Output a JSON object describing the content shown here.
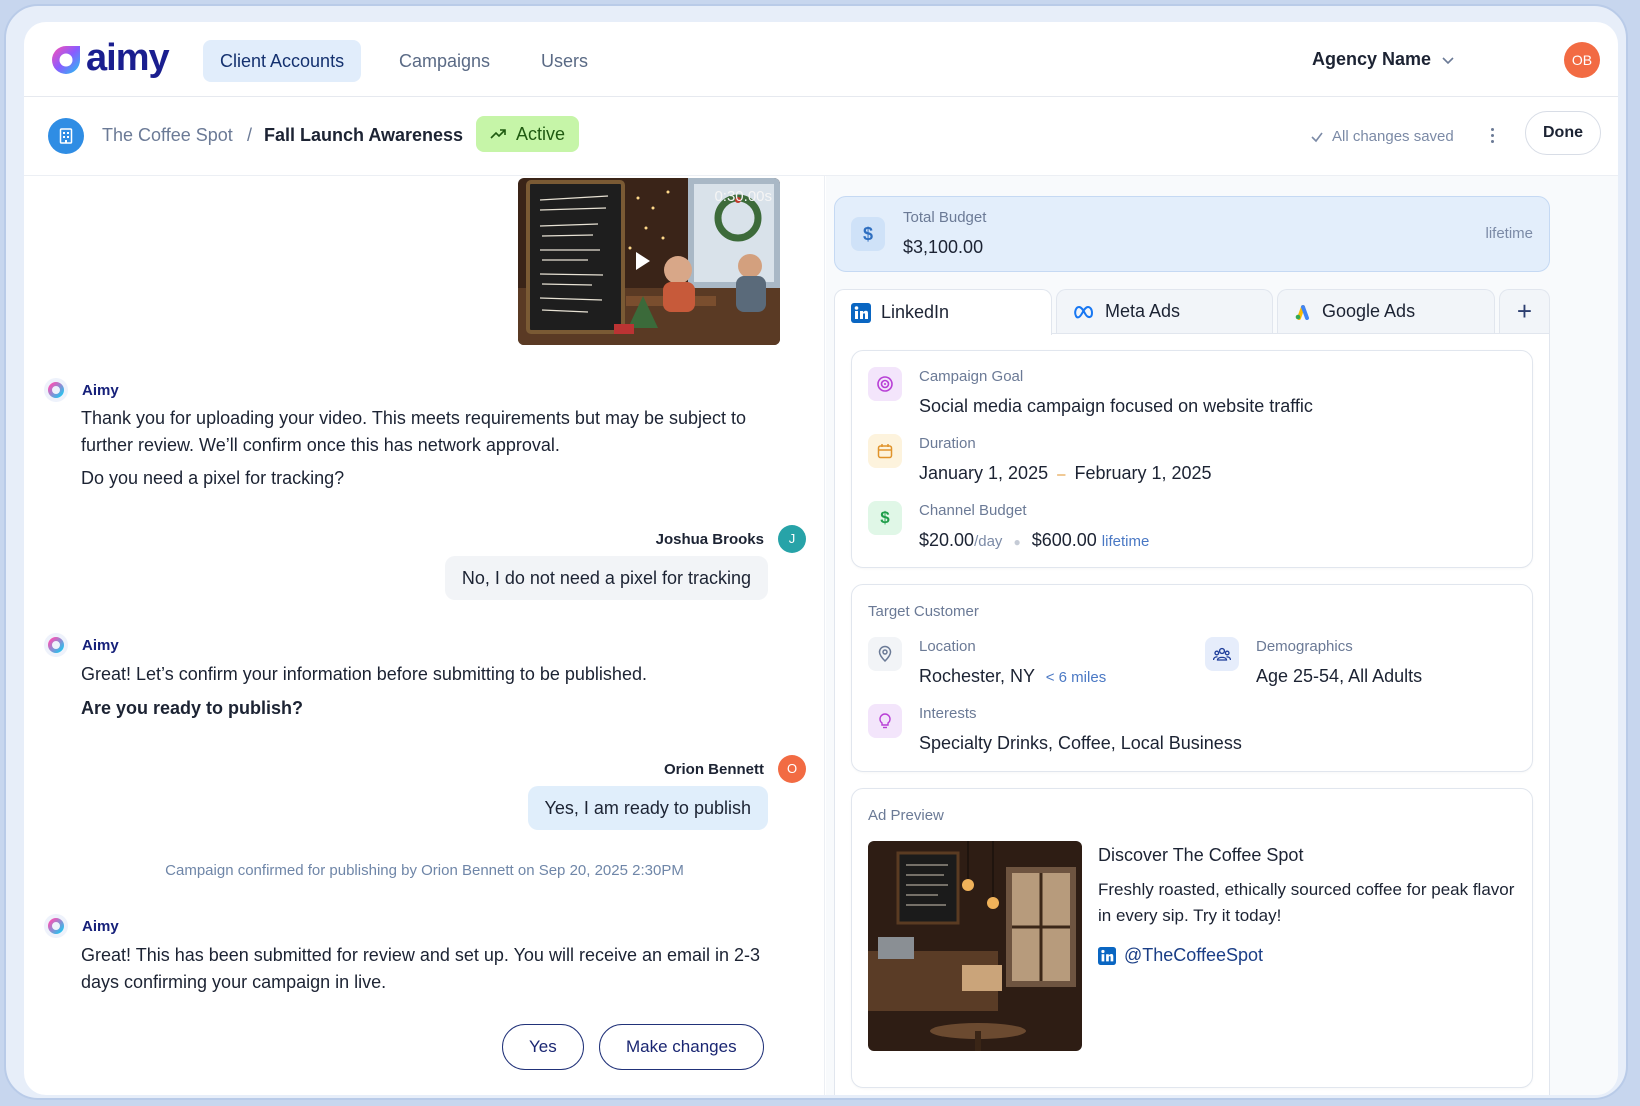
{
  "app": {
    "logo_text": "aimy",
    "brand_color": "#1a1e8f"
  },
  "nav": {
    "tabs": [
      {
        "label": "Client Accounts",
        "active": true
      },
      {
        "label": "Campaigns",
        "active": false
      },
      {
        "label": "Users",
        "active": false
      }
    ],
    "agency": "Agency Name",
    "user_initials": "OB"
  },
  "subheader": {
    "client": "The Coffee Spot",
    "separator": "/",
    "campaign": "Fall Launch Awareness",
    "status": "Active",
    "saved_text": "All changes saved",
    "done_label": "Done"
  },
  "chat": {
    "video_duration": "0:30.00s",
    "assistant_name": "Aimy",
    "messages": [
      {
        "text": "Thank you for uploading your video. This meets requirements but may be subject to further review. We’ll confirm once this has network approval."
      },
      {
        "text": "Do you need a pixel for tracking?"
      }
    ],
    "reply1": {
      "name": "Joshua Brooks",
      "initial": "J",
      "color": "#27a3a8",
      "text": "No, I do not need a pixel for tracking"
    },
    "aimy2": {
      "text": "Great! Let’s confirm your information before submitting to be published.",
      "bold_text": "Are you ready to publish?"
    },
    "reply2": {
      "name": "Orion Bennett",
      "initial": "O",
      "color": "#f26b43",
      "text": "Yes, I am ready to publish"
    },
    "system_note": "Campaign confirmed for publishing by Orion Bennett on Sep 20, 2025 2:30PM",
    "aimy3": {
      "text": "Great! This has been submitted for review and set up. You will receive an email in 2-3 days confirming your campaign in live."
    },
    "actions": {
      "yes_label": "Yes",
      "changes_label": "Make changes"
    }
  },
  "budget": {
    "label": "Total Budget",
    "value": "$3,100.00",
    "period": "lifetime"
  },
  "channels": {
    "tabs": [
      {
        "label": "LinkedIn",
        "icon": "linkedin-icon",
        "active": true
      },
      {
        "label": "Meta Ads",
        "icon": "meta-icon",
        "active": false
      },
      {
        "label": "Google Ads",
        "icon": "google-ads-icon",
        "active": false
      }
    ],
    "add_label": "+"
  },
  "campaign_info": {
    "goal_label": "Campaign Goal",
    "goal_value": "Social media campaign focused on website traffic",
    "duration_label": "Duration",
    "duration_start": "January 1, 2025",
    "duration_dash": "–",
    "duration_end": "February 1, 2025",
    "budget_label": "Channel Budget",
    "daily_value": "$20.00",
    "daily_unit": "/day",
    "lifetime_value": "$600.00",
    "lifetime_unit": "lifetime"
  },
  "target": {
    "title": "Target Customer",
    "location_label": "Location",
    "location_value": "Rochester, NY",
    "radius": "< 6 miles",
    "demo_label": "Demographics",
    "demo_value": "Age 25-54, All Adults",
    "interests_label": "Interests",
    "interests_value": "Specialty Drinks, Coffee, Local Business"
  },
  "ad_preview": {
    "title": "Ad Preview",
    "headline": "Discover The Coffee Spot",
    "body": "Freshly roasted, ethically sourced coffee for peak flavor in every sip. Try it today!",
    "handle": "@TheCoffeeSpot"
  }
}
